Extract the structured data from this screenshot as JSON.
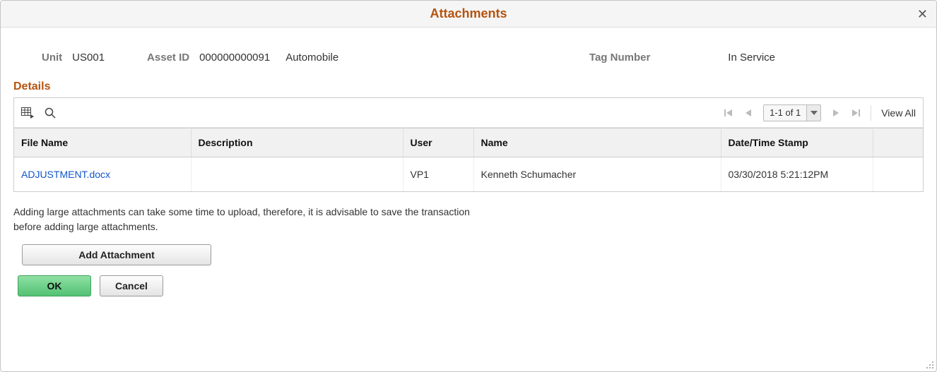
{
  "modal": {
    "title": "Attachments"
  },
  "info": {
    "unit_label": "Unit",
    "unit_value": "US001",
    "asset_id_label": "Asset ID",
    "asset_id_value": "000000000091",
    "asset_desc": "Automobile",
    "tag_label": "Tag Number",
    "status": "In Service"
  },
  "section": {
    "details_title": "Details"
  },
  "toolbar": {
    "row_counter": "1-1 of 1",
    "view_all": "View All"
  },
  "grid": {
    "columns": {
      "file_name": "File Name",
      "description": "Description",
      "user": "User",
      "name": "Name",
      "datetime": "Date/Time Stamp"
    },
    "rows": [
      {
        "file_name": "ADJUSTMENT.docx",
        "description": "",
        "user": "VP1",
        "name": "Kenneth Schumacher",
        "datetime": "03/30/2018  5:21:12PM"
      }
    ]
  },
  "note": "Adding large attachments can take some time to upload, therefore, it is advisable to save the transaction before adding large attachments.",
  "buttons": {
    "add_attachment": "Add Attachment",
    "ok": "OK",
    "cancel": "Cancel"
  }
}
